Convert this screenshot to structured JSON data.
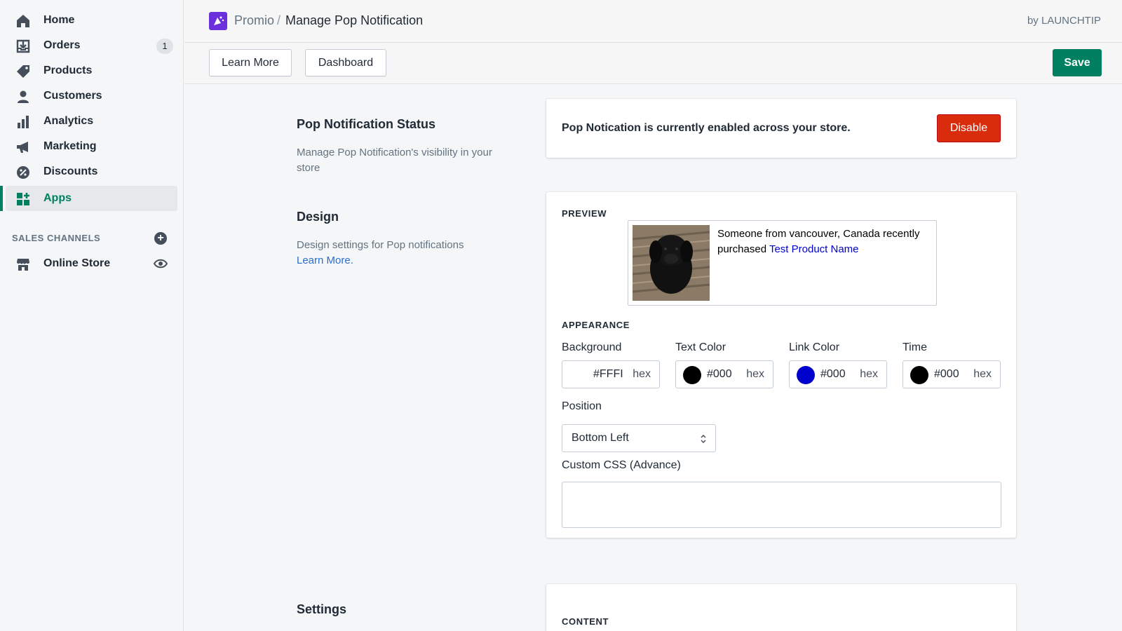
{
  "sidebar": {
    "items": [
      {
        "label": "Home",
        "icon": "home-icon"
      },
      {
        "label": "Orders",
        "icon": "orders-icon",
        "badge": "1"
      },
      {
        "label": "Products",
        "icon": "tag-icon"
      },
      {
        "label": "Customers",
        "icon": "person-icon"
      },
      {
        "label": "Analytics",
        "icon": "bar-chart-icon"
      },
      {
        "label": "Marketing",
        "icon": "megaphone-icon"
      },
      {
        "label": "Discounts",
        "icon": "discount-icon"
      },
      {
        "label": "Apps",
        "icon": "apps-icon",
        "active": true
      }
    ],
    "sales_channels": {
      "title": "SALES CHANNELS",
      "items": [
        {
          "label": "Online Store",
          "icon": "store-icon"
        }
      ]
    }
  },
  "header": {
    "app_name": "Promio",
    "separator": "/",
    "page_title": "Manage Pop Notification",
    "by_line": "by LAUNCHTIP"
  },
  "actions": {
    "learn_more": "Learn More",
    "dashboard": "Dashboard",
    "save": "Save"
  },
  "status_section": {
    "title": "Pop Notification Status",
    "description": "Manage Pop Notification's visibility in your store",
    "status_text": "Pop Notication is currently enabled across your store.",
    "disable_label": "Disable"
  },
  "design_section": {
    "title": "Design",
    "description": "Design settings for Pop notifications",
    "learn_more_link": "Learn More.",
    "preview_heading": "PREVIEW",
    "preview_text": "Someone from vancouver, Canada recently purchased",
    "preview_product": "Test Product Name",
    "appearance_heading": "APPEARANCE",
    "colors": [
      {
        "label": "Background",
        "value": "#FFFI",
        "suffix": "hex",
        "swatch": "#ffffff"
      },
      {
        "label": "Text Color",
        "value": "#000",
        "suffix": "hex",
        "swatch": "#000000"
      },
      {
        "label": "Link Color",
        "value": "#000",
        "suffix": "hex",
        "swatch": "#0000cc"
      },
      {
        "label": "Time",
        "value": "#000",
        "suffix": "hex",
        "swatch": "#000000"
      }
    ],
    "position_label": "Position",
    "position_value": "Bottom Left",
    "custom_css_label": "Custom CSS (Advance)",
    "custom_css_value": ""
  },
  "settings_section": {
    "title": "Settings",
    "content_heading": "CONTENT"
  },
  "theme": {
    "accent": "#008060",
    "danger": "#d82c0d",
    "link": "#2c6ecb",
    "app_logo": "#6b2fdc"
  }
}
